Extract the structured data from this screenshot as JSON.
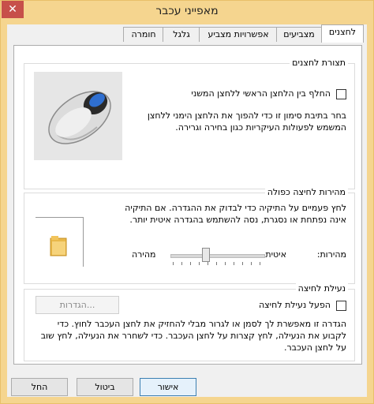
{
  "window": {
    "title": "מאפייני עכבר",
    "close_glyph": "✕"
  },
  "tabs": [
    "לחצנים",
    "מצביעים",
    "אפשרויות מצביע",
    "גלגל",
    "חומרה"
  ],
  "buttons_config": {
    "title": "תצורת לחצנים",
    "switch_label": "החלף בין הלחצן הראשי ללחצן המשני",
    "description": "בחר בתיבת סימון זו כדי להפוך את הלחצן הימני ללחצן המשמש לפעולות העיקריות כגון בחירה וגרירה."
  },
  "double_click": {
    "title": "מהירות לחיצה כפולה",
    "description": "לחץ פעמיים על התיקיה כדי לבדוק את ההגדרה. אם התיקיה אינה נפתחת או נסגרת, נסה להשתמש בהגדרה איטית יותר.",
    "speed_label": "מהירות:",
    "slow_label": "איטית",
    "fast_label": "מהירה",
    "speed_value": 0.55
  },
  "click_lock": {
    "title": "נעילת לחיצה",
    "enable_label": "הפעל נעילת לחיצה",
    "settings_button": "הגדרות...",
    "description": "הגדרה זו מאפשרת לך לסמן או לגרור מבלי להחזיק את לחצן העכבר לחוץ. כדי לקבוע את הנעילה, לחץ קצרות על לחצן העכבר. כדי לשחרר את הנעילה, לחץ שוב על לחצן העכבר."
  },
  "footer": {
    "ok": "אישור",
    "cancel": "ביטול",
    "apply": "החל"
  }
}
